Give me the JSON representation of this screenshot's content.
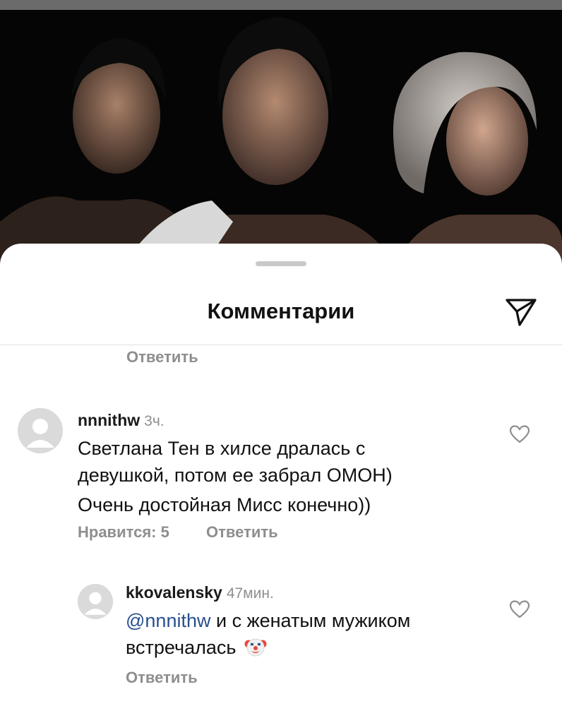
{
  "sheet": {
    "title": "Комментарии"
  },
  "previous_reply": {
    "reply_label": "Ответить"
  },
  "comments": [
    {
      "username": "nnnithw",
      "time": "3ч.",
      "lines": [
        "Светлана Тен в хилсе дралась с",
        "девушкой, потом ее забрал ОМОН)",
        "Очень достойная Мисс конечно))"
      ],
      "likes_label": "Нравится: 5",
      "reply_label": "Ответить"
    },
    {
      "username": "kkovalensky",
      "time": "47мин.",
      "mention": "@nnnithw",
      "line1_rest": " и с женатым мужиком",
      "line2": "встречалась",
      "emoji": "clown-face-icon",
      "reply_label": "Ответить"
    }
  ],
  "icons": {
    "share": "paper-plane-icon",
    "like": "heart-icon",
    "avatar": "default-avatar-icon"
  },
  "colors": {
    "mention": "#2a4f8f",
    "muted": "#8e8e8e"
  }
}
